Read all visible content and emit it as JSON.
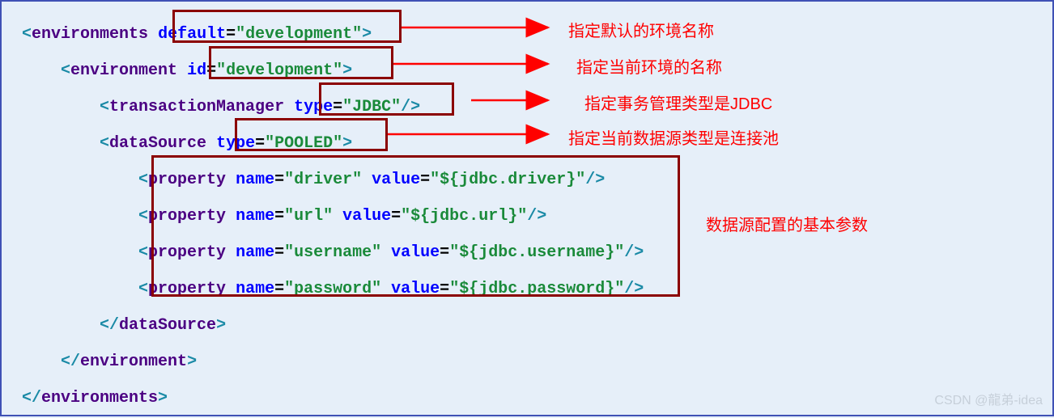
{
  "code": {
    "line1": {
      "tag": "environments",
      "attr": "default",
      "val": "\"development\""
    },
    "line2": {
      "tag": "environment",
      "attr": "id",
      "val": "\"development\""
    },
    "line3": {
      "tag": "transactionManager",
      "attr": "type",
      "val": "\"JDBC\""
    },
    "line4": {
      "tag": "dataSource",
      "attr": "type",
      "val": "\"POOLED\""
    },
    "line5": {
      "tag": "property",
      "a1": "name",
      "v1": "\"driver\"",
      "a2": "value",
      "v2": "\"${jdbc.driver}\""
    },
    "line6": {
      "tag": "property",
      "a1": "name",
      "v1": "\"url\"",
      "a2": "value",
      "v2": "\"${jdbc.url}\""
    },
    "line7": {
      "tag": "property",
      "a1": "name",
      "v1": "\"username\"",
      "a2": "value",
      "v2": "\"${jdbc.username}\""
    },
    "line8": {
      "tag": "property",
      "a1": "name",
      "v1": "\"password\"",
      "a2": "value",
      "v2": "\"${jdbc.password}\""
    },
    "line9": {
      "tag": "dataSource"
    },
    "line10": {
      "tag": "environment"
    },
    "line11": {
      "tag": "environments"
    }
  },
  "ann": {
    "a1": "指定默认的环境名称",
    "a2": "指定当前环境的名称",
    "a3": "指定事务管理类型是JDBC",
    "a4": "指定当前数据源类型是连接池",
    "a5": "数据源配置的基本参数"
  },
  "watermark": "CSDN @龍弟-idea"
}
